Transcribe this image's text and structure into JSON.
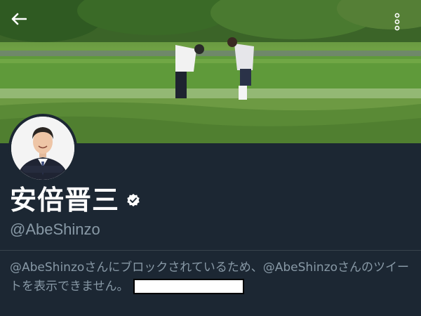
{
  "profile": {
    "display_name": "安倍晋三",
    "handle": "@AbeShinzo",
    "verified": true
  },
  "block_notice": {
    "text": "@AbeShinzoさんにブロックされているため、@AbeShinzoさんのツイートを表示できません。"
  },
  "icons": {
    "back": "arrow-left-icon",
    "more": "more-vertical-icon",
    "verified": "verified-badge-icon"
  },
  "colors": {
    "background": "#1c2733",
    "secondary_text": "#8899a6",
    "primary_text": "#ffffff",
    "divider": "#38444d"
  }
}
